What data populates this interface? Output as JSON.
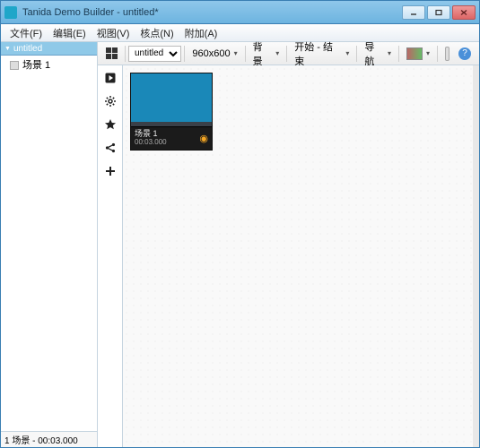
{
  "window": {
    "title": "Tanida Demo Builder - untitled*"
  },
  "menu": {
    "file": "文件(F)",
    "edit": "编辑(E)",
    "view": "视图(V)",
    "tools": "核点(N)",
    "addons": "附加(A)"
  },
  "left": {
    "header": "untitled",
    "scenes": [
      {
        "label": "场景 1"
      }
    ],
    "status": "1 场景 - 00:03.000"
  },
  "toolbar": {
    "project_name": "untitled",
    "resolution": "960x600",
    "background": "背景",
    "range": "开始 - 结束",
    "nav": "导航"
  },
  "thumb": {
    "name": "场景 1",
    "time": "00:03.000"
  }
}
